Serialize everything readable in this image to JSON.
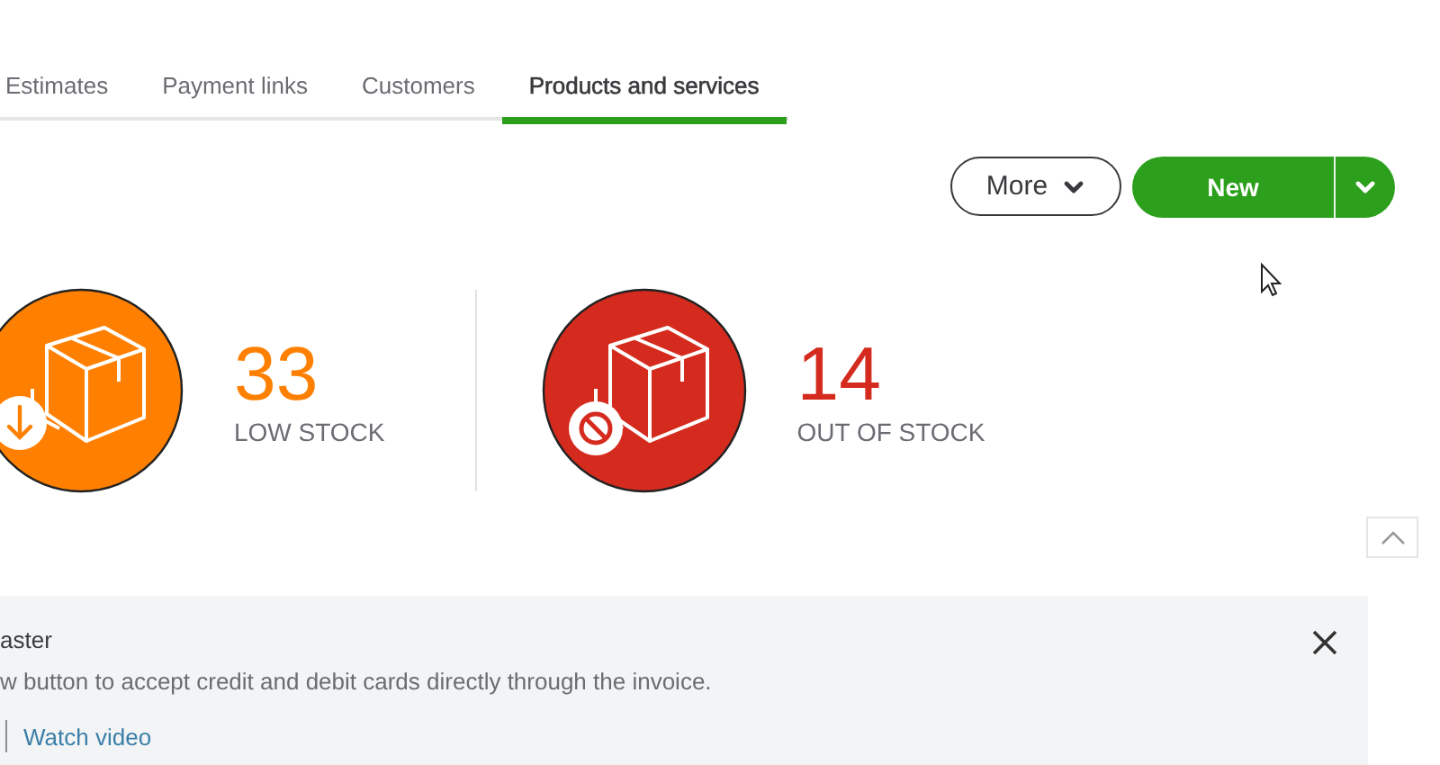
{
  "tabs": [
    {
      "label": "Estimates",
      "selected": false
    },
    {
      "label": "Payment links",
      "selected": false
    },
    {
      "label": "Customers",
      "selected": false
    },
    {
      "label": "Products and services",
      "selected": true
    }
  ],
  "actions": {
    "more": "More",
    "new": "New"
  },
  "stats": [
    {
      "kind": "low",
      "value": "33",
      "label": "LOW STOCK",
      "color": "#ff8000"
    },
    {
      "kind": "out",
      "value": "14",
      "label": "OUT OF STOCK",
      "color": "#d52b1e"
    }
  ],
  "banner": {
    "title": "aster",
    "text": "w button to accept credit and debit cards directly through the invoice.",
    "link": "Watch video"
  }
}
